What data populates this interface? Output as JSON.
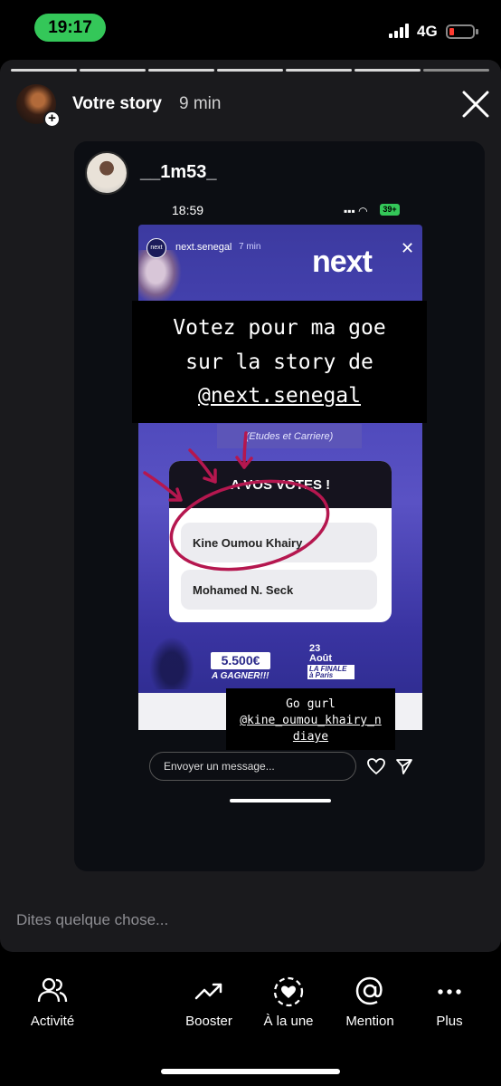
{
  "status_bar": {
    "time": "19:17",
    "network": "4G"
  },
  "story_header": {
    "title": "Votre story",
    "age": "9 min"
  },
  "shared_story": {
    "username": "__1m53_",
    "screenshot_time": "18:59",
    "screenshot_battery": "39+",
    "poster": {
      "account": "next.senegal",
      "account_age": "7 min",
      "brand": "next",
      "subtitle": "(Etudes et Carriere)",
      "vote_title": "A VOS VOTES !",
      "options": [
        "Kine Oumou Khairy",
        "Mohamed N. Seck"
      ],
      "prize": "5.500€",
      "prize_sub": "A GAGNER!!!",
      "date_day": "23",
      "date_month": "Août",
      "finale": "LA FINALE",
      "finale_place": "à Paris"
    },
    "caption": {
      "line1": "Votez pour ma goe",
      "line2": "sur la story de",
      "line3": "@next.senegal"
    },
    "caption2": {
      "line1": "Go gurl",
      "line2": "@kine_oumou_khairy_n",
      "line3": "diaye"
    },
    "message_placeholder": "Envoyer un message..."
  },
  "reply_placeholder": "Dites quelque chose...",
  "toolbar": {
    "activity": "Activité",
    "boost": "Booster",
    "highlight": "À la une",
    "mention": "Mention",
    "more": "Plus"
  },
  "colors": {
    "accent_green": "#34c759",
    "poll_ring": "#b5174f"
  }
}
